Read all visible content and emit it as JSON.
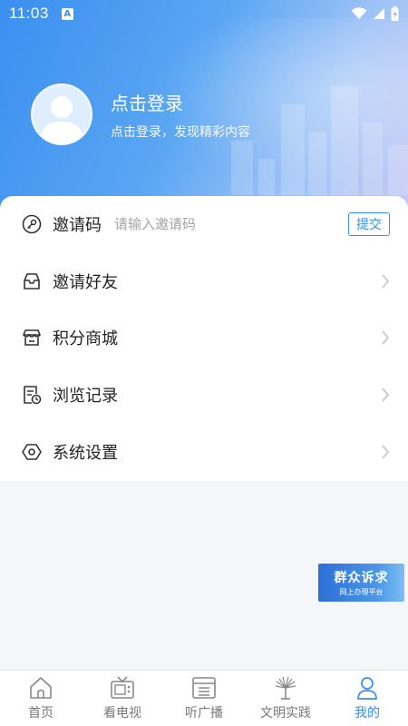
{
  "status_bar": {
    "time": "11:03",
    "notification_letter": "A"
  },
  "profile": {
    "title": "点击登录",
    "subtitle": "点击登录，发现精彩内容"
  },
  "invite": {
    "label": "邀请码",
    "placeholder": "请输入邀请码",
    "submit_label": "提交"
  },
  "menu": {
    "items": [
      {
        "label": "邀请好友",
        "icon": "mail-icon"
      },
      {
        "label": "积分商城",
        "icon": "store-icon"
      },
      {
        "label": "浏览记录",
        "icon": "history-icon"
      },
      {
        "label": "系统设置",
        "icon": "settings-icon"
      }
    ]
  },
  "appeal_badge": {
    "title": "群众诉求",
    "subtitle": "网上办理平台"
  },
  "bottom_nav": {
    "items": [
      {
        "label": "首页",
        "icon": "home-icon"
      },
      {
        "label": "看电视",
        "icon": "tv-icon"
      },
      {
        "label": "听广播",
        "icon": "radio-icon"
      },
      {
        "label": "文明实践",
        "icon": "civic-icon"
      },
      {
        "label": "我的",
        "icon": "user-icon",
        "active": true
      }
    ]
  },
  "colors": {
    "accent": "#3b8ff0",
    "gradient_start": "#3b8ff0",
    "gradient_end": "#c7c9f3"
  }
}
